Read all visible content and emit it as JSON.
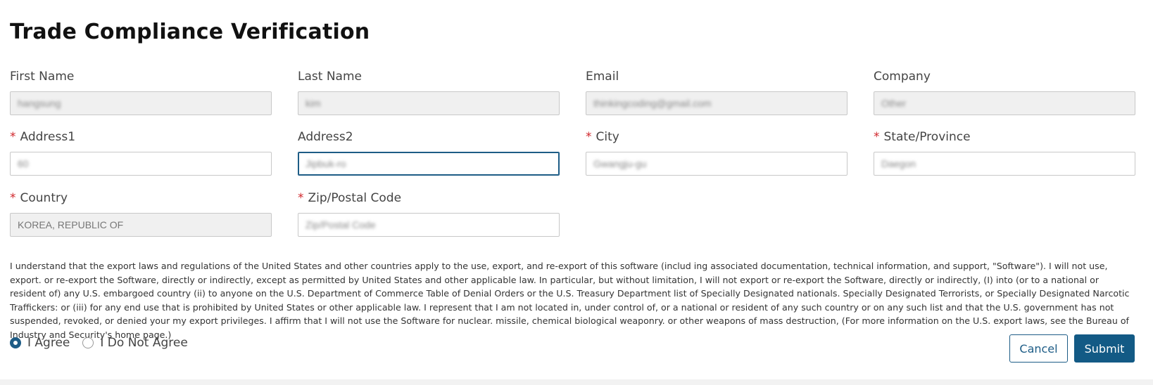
{
  "form": {
    "title": "Trade Compliance Verification",
    "fields": [
      {
        "label": "First Name",
        "required": false,
        "value": "hangsung",
        "placeholder": "",
        "readonly": true
      },
      {
        "label": "Last Name",
        "required": false,
        "value": "kim",
        "placeholder": "",
        "readonly": true
      },
      {
        "label": "Email",
        "required": false,
        "value": "thinkingcoding@gmail.com",
        "placeholder": "",
        "readonly": true
      },
      {
        "label": "Company",
        "required": false,
        "value": "Other",
        "placeholder": "",
        "readonly": true
      },
      {
        "label": "Address1",
        "required": true,
        "value": "60",
        "placeholder": "",
        "readonly": false
      },
      {
        "label": "Address2",
        "required": false,
        "value": "Jipbuk-ro",
        "placeholder": "",
        "readonly": false
      },
      {
        "label": "City",
        "required": true,
        "value": "Gwangju-gu",
        "placeholder": "",
        "readonly": false
      },
      {
        "label": "State/Province",
        "required": true,
        "value": "Daegon",
        "placeholder": "",
        "readonly": false
      },
      {
        "label": "Country",
        "required": true,
        "value": "KOREA, REPUBLIC OF",
        "placeholder": "",
        "readonly": true
      },
      {
        "label": "Zip/Postal Code",
        "required": true,
        "value": "",
        "placeholder": "Zip/Postal Code",
        "readonly": false
      }
    ],
    "required_marker": "*",
    "disclaimer": "I understand that the export laws and regulations of the United States and other countries apply to the use, export, and re-export of this software (includ ing associated documentation, technical information, and support, \"Software\"). I will not use, export. or re-export the Software, directly or indirectly, except as permitted by United States and other applicable law. In particular, but without limitation, I will not export or re-export the Software, directly or indirectly, (I) into (or to a national or resident of) any U.S. embargoed country (ii) to anyone on the U.S. Department of Commerce Table of Denial Orders or the U.S. Treasury Department list of Specially Designated nationals. Specially Designated Terrorists, or Specially Designated Narcotic Traffickers: or (iii) for any end use that is prohibited by United States or other applicable law. I represent that I am not located in, under control of, or a national or resident of any such country or on any such list and that the U.S. government has not suspended, revoked, or denied your my export privileges. I affirm that I will not use the Software for nuclear. missile, chemical biological weaponry. or other weapons of mass destruction, (For more information on the U.S. export laws, see the Bureau of Industry and Security's home page.)",
    "agreement": {
      "agree_label": "I Agree",
      "disagree_label": "I Do Not Agree",
      "selected": "agree"
    },
    "buttons": {
      "cancel_label": "Cancel",
      "submit_label": "Submit"
    }
  },
  "colors": {
    "accent": "#135a85",
    "required": "#d0262b"
  }
}
